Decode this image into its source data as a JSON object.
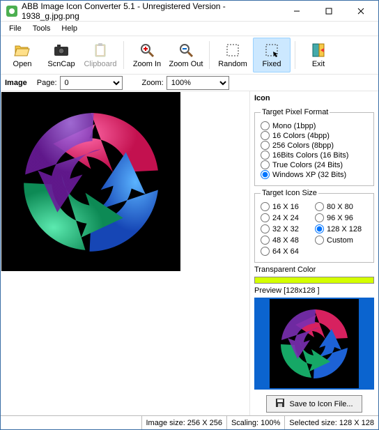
{
  "title": "ABB Image Icon Converter 5.1 - Unregistered Version - 1938_g.jpg.png",
  "menu": {
    "file": "File",
    "tools": "Tools",
    "help": "Help"
  },
  "toolbar": {
    "open": "Open",
    "scncap": "ScnCap",
    "clipboard": "Clipboard",
    "zoomin": "Zoom In",
    "zoomout": "Zoom Out",
    "random": "Random",
    "fixed": "Fixed",
    "exit": "Exit"
  },
  "infobar": {
    "image_lbl": "Image",
    "page_lbl": "Page:",
    "page_val": "0",
    "zoom_lbl": "Zoom:",
    "zoom_val": "100%"
  },
  "right": {
    "header": "Icon",
    "pixel_legend": "Target Pixel Format",
    "pixel_opts": [
      "Mono (1bpp)",
      "16 Colors (4bpp)",
      "256 Colors (8bpp)",
      "16Bits Colors (16 Bits)",
      "True Colors (24 Bits)",
      "Windows XP (32 Bits)"
    ],
    "pixel_selected": 5,
    "size_legend": "Target Icon Size",
    "size_left": [
      "16 X 16",
      "24 X 24",
      "32 X 32",
      "48 X 48",
      "64 X 64"
    ],
    "size_right": [
      "80 X 80",
      "96 X 96",
      "128 X 128",
      "Custom"
    ],
    "size_selected": "128 X 128",
    "trans_lbl": "Transparent Color",
    "trans_color": "#d4ff00",
    "preview_lbl": "Preview [128x128 ]",
    "save_lbl": "Save to Icon File..."
  },
  "status": {
    "imgsize": "Image size: 256 X 256",
    "scaling": "Scaling: 100%",
    "selsize": "Selected size: 128 X 128"
  }
}
